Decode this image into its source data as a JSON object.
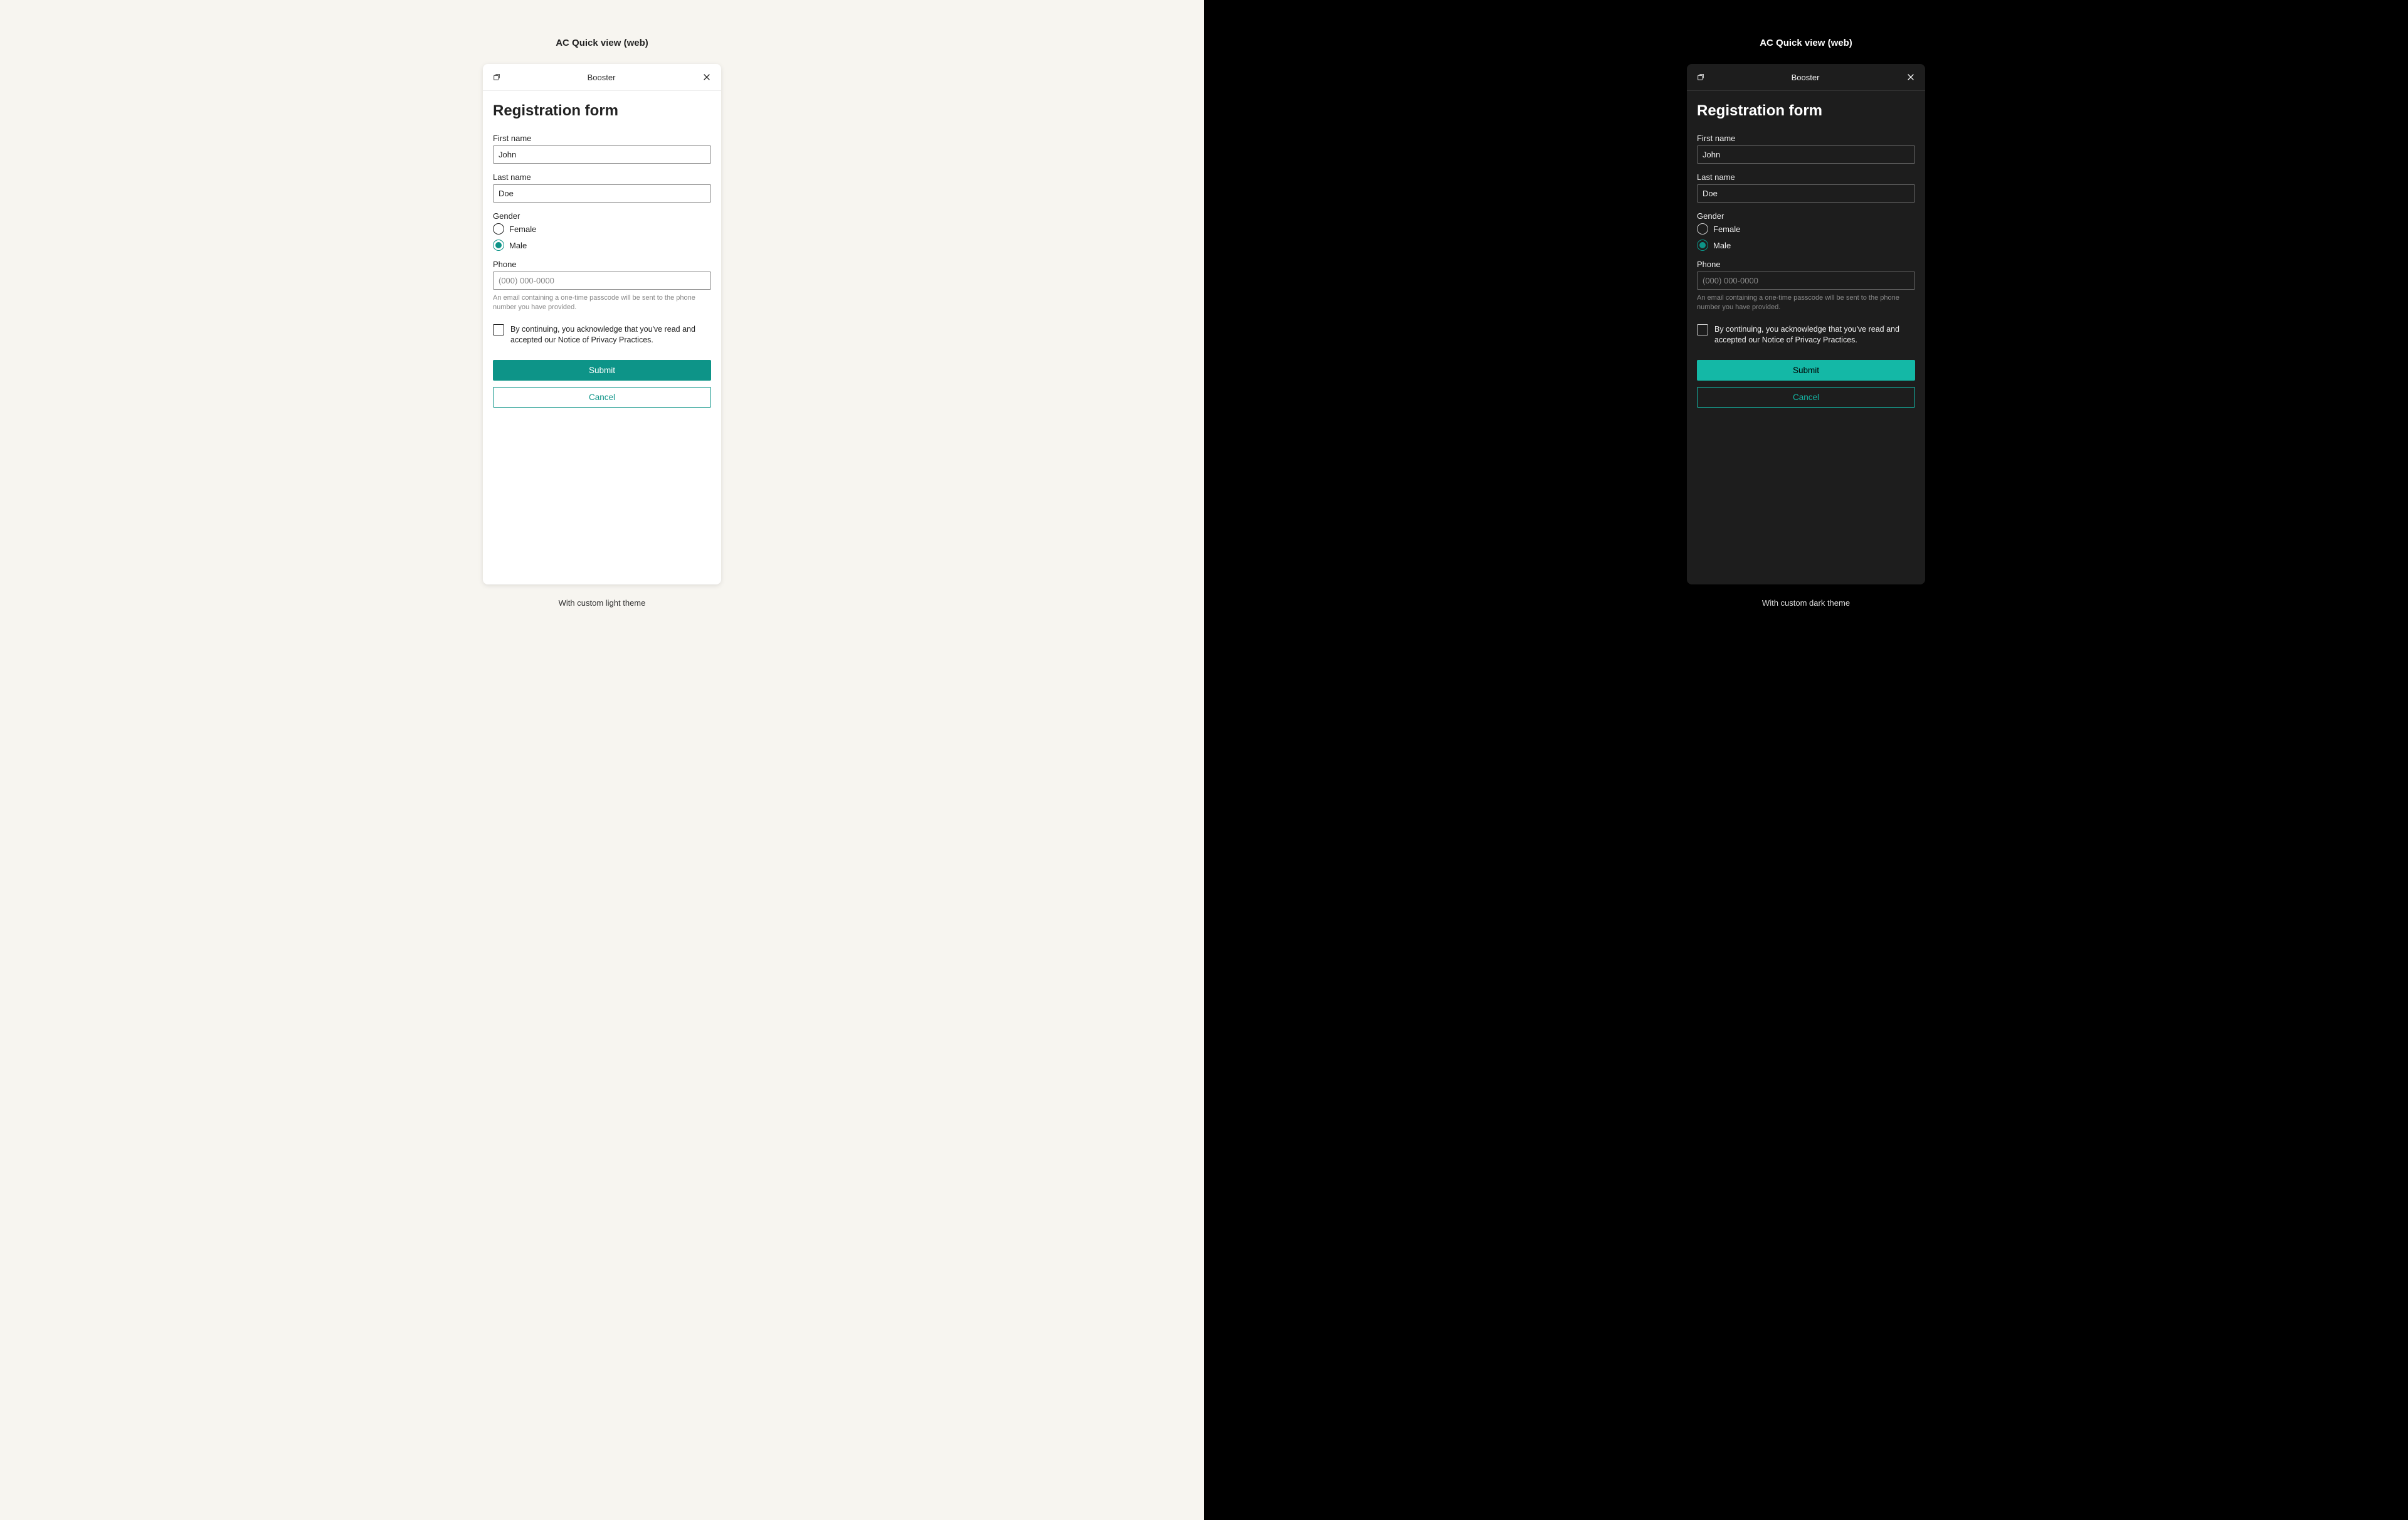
{
  "pageTitle": "AC Quick view (web)",
  "cardTitle": "Booster",
  "formTitle": "Registration form",
  "fields": {
    "firstName": {
      "label": "First name",
      "value": "John"
    },
    "lastName": {
      "label": "Last name",
      "value": "Doe"
    },
    "gender": {
      "label": "Gender",
      "options": {
        "female": "Female",
        "male": "Male"
      },
      "selected": "male"
    },
    "phone": {
      "label": "Phone",
      "placeholder": "(000) 000-0000",
      "help": "An email containing a one-time passcode will be sent to the phone number you have provided."
    }
  },
  "consent": "By continuing, you acknowledge that you've read and accepted our Notice of Privacy Practices.",
  "buttons": {
    "submit": "Submit",
    "cancel": "Cancel"
  },
  "captions": {
    "light": "With custom light theme",
    "dark": "With custom dark theme"
  }
}
